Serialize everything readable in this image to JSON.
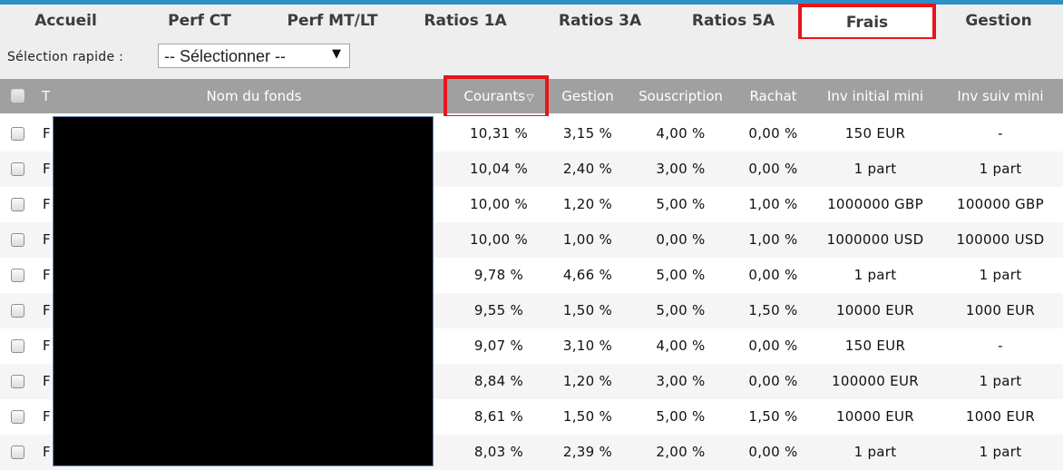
{
  "tabs": [
    {
      "label": "Accueil",
      "active": false
    },
    {
      "label": "Perf CT",
      "active": false
    },
    {
      "label": "Perf MT/LT",
      "active": false
    },
    {
      "label": "Ratios 1A",
      "active": false
    },
    {
      "label": "Ratios 3A",
      "active": false
    },
    {
      "label": "Ratios 5A",
      "active": false
    },
    {
      "label": "Frais",
      "active": true
    },
    {
      "label": "Gestion",
      "active": false
    }
  ],
  "quick_select": {
    "label": "Sélection rapide :",
    "value": "-- Sélectionner --"
  },
  "table": {
    "columns": {
      "type": "T",
      "name": "Nom du fonds",
      "courants": "Courants",
      "gestion": "Gestion",
      "souscription": "Souscription",
      "rachat": "Rachat",
      "inv_initial": "Inv initial mini",
      "inv_suiv": "Inv suiv mini"
    },
    "sort_icon": "sort-descending-icon",
    "rows": [
      {
        "type": "F",
        "courants": "10,31 %",
        "gestion": "3,15 %",
        "souscription": "4,00 %",
        "rachat": "0,00 %",
        "inv_initial": "150 EUR",
        "inv_suiv": "-"
      },
      {
        "type": "F",
        "courants": "10,04 %",
        "gestion": "2,40 %",
        "souscription": "3,00 %",
        "rachat": "0,00 %",
        "inv_initial": "1 part",
        "inv_suiv": "1 part"
      },
      {
        "type": "F",
        "courants": "10,00 %",
        "gestion": "1,20 %",
        "souscription": "5,00 %",
        "rachat": "1,00 %",
        "inv_initial": "1000000 GBP",
        "inv_suiv": "100000 GBP"
      },
      {
        "type": "F",
        "courants": "10,00 %",
        "gestion": "1,00 %",
        "souscription": "0,00 %",
        "rachat": "1,00 %",
        "inv_initial": "1000000 USD",
        "inv_suiv": "100000 USD"
      },
      {
        "type": "F",
        "courants": "9,78 %",
        "gestion": "4,66 %",
        "souscription": "5,00 %",
        "rachat": "0,00 %",
        "inv_initial": "1 part",
        "inv_suiv": "1 part"
      },
      {
        "type": "F",
        "courants": "9,55 %",
        "gestion": "1,50 %",
        "souscription": "5,00 %",
        "rachat": "1,50 %",
        "inv_initial": "10000 EUR",
        "inv_suiv": "1000 EUR"
      },
      {
        "type": "F",
        "courants": "9,07 %",
        "gestion": "3,10 %",
        "souscription": "4,00 %",
        "rachat": "0,00 %",
        "inv_initial": "150 EUR",
        "inv_suiv": "-"
      },
      {
        "type": "F",
        "courants": "8,84 %",
        "gestion": "1,20 %",
        "souscription": "3,00 %",
        "rachat": "0,00 %",
        "inv_initial": "100000 EUR",
        "inv_suiv": "1 part"
      },
      {
        "type": "F",
        "courants": "8,61 %",
        "gestion": "1,50 %",
        "souscription": "5,00 %",
        "rachat": "1,50 %",
        "inv_initial": "10000 EUR",
        "inv_suiv": "1000 EUR"
      },
      {
        "type": "F",
        "courants": "8,03 %",
        "gestion": "2,39 %",
        "souscription": "2,00 %",
        "rachat": "0,00 %",
        "inv_initial": "1 part",
        "inv_suiv": "1 part"
      }
    ]
  },
  "colors": {
    "accent": "#2f8fc7",
    "highlight": "#e8141b",
    "header_bg": "#a0a0a0",
    "tab_bg": "#eeeeee"
  }
}
